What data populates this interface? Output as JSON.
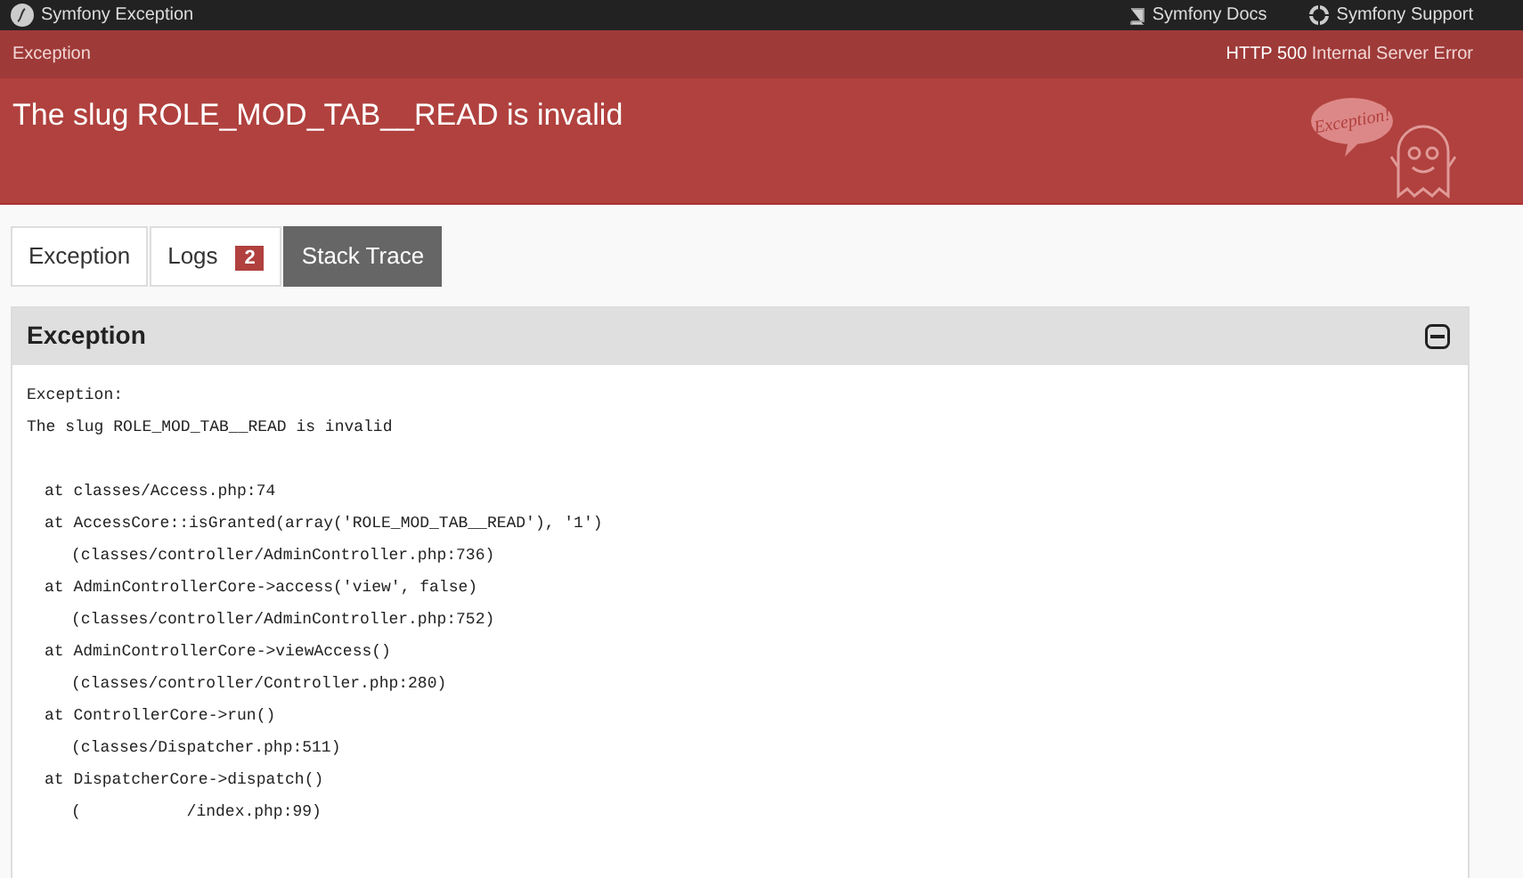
{
  "topbar": {
    "title": "Symfony Exception",
    "links": [
      {
        "kind": "docs",
        "label": "Symfony Docs"
      },
      {
        "kind": "support",
        "label": "Symfony Support"
      }
    ]
  },
  "header": {
    "section": "Exception",
    "status_code": "HTTP 500",
    "status_text": "Internal Server Error",
    "message": "The slug ROLE_MOD_TAB__READ is invalid",
    "mascot_bubble": "Exception!"
  },
  "tabs": [
    {
      "label": "Exception",
      "selected": false
    },
    {
      "label": "Logs",
      "badge": "2",
      "selected": false
    },
    {
      "label": "Stack Trace",
      "selected": true
    }
  ],
  "panel": {
    "title": "Exception",
    "expanded": true,
    "intro": [
      "Exception:",
      "The slug ROLE_MOD_TAB__READ is invalid"
    ],
    "trace": [
      {
        "kind": "call",
        "text": "at classes/Access.php:74"
      },
      {
        "kind": "call",
        "text": "at AccessCore::isGranted(array('ROLE_MOD_TAB__READ'), '1')"
      },
      {
        "kind": "file",
        "text": "(classes/controller/AdminController.php:736)"
      },
      {
        "kind": "call",
        "text": "at AdminControllerCore->access('view', false)"
      },
      {
        "kind": "file",
        "text": "(classes/controller/AdminController.php:752)"
      },
      {
        "kind": "call",
        "text": "at AdminControllerCore->viewAccess()"
      },
      {
        "kind": "file",
        "text": "(classes/controller/Controller.php:280)"
      },
      {
        "kind": "call",
        "text": "at ControllerCore->run()"
      },
      {
        "kind": "file",
        "text": "(classes/Dispatcher.php:511)"
      },
      {
        "kind": "call",
        "text": "at DispatcherCore->dispatch()"
      },
      {
        "kind": "file",
        "text": "(           /index.php:99)"
      }
    ]
  }
}
